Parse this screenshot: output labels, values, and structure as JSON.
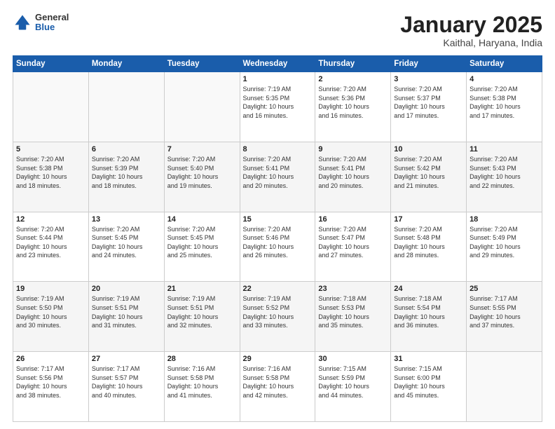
{
  "header": {
    "logo_general": "General",
    "logo_blue": "Blue",
    "title": "January 2025",
    "location": "Kaithal, Haryana, India"
  },
  "days_of_week": [
    "Sunday",
    "Monday",
    "Tuesday",
    "Wednesday",
    "Thursday",
    "Friday",
    "Saturday"
  ],
  "weeks": [
    [
      {
        "day": "",
        "info": ""
      },
      {
        "day": "",
        "info": ""
      },
      {
        "day": "",
        "info": ""
      },
      {
        "day": "1",
        "info": "Sunrise: 7:19 AM\nSunset: 5:35 PM\nDaylight: 10 hours\nand 16 minutes."
      },
      {
        "day": "2",
        "info": "Sunrise: 7:20 AM\nSunset: 5:36 PM\nDaylight: 10 hours\nand 16 minutes."
      },
      {
        "day": "3",
        "info": "Sunrise: 7:20 AM\nSunset: 5:37 PM\nDaylight: 10 hours\nand 17 minutes."
      },
      {
        "day": "4",
        "info": "Sunrise: 7:20 AM\nSunset: 5:38 PM\nDaylight: 10 hours\nand 17 minutes."
      }
    ],
    [
      {
        "day": "5",
        "info": "Sunrise: 7:20 AM\nSunset: 5:38 PM\nDaylight: 10 hours\nand 18 minutes."
      },
      {
        "day": "6",
        "info": "Sunrise: 7:20 AM\nSunset: 5:39 PM\nDaylight: 10 hours\nand 18 minutes."
      },
      {
        "day": "7",
        "info": "Sunrise: 7:20 AM\nSunset: 5:40 PM\nDaylight: 10 hours\nand 19 minutes."
      },
      {
        "day": "8",
        "info": "Sunrise: 7:20 AM\nSunset: 5:41 PM\nDaylight: 10 hours\nand 20 minutes."
      },
      {
        "day": "9",
        "info": "Sunrise: 7:20 AM\nSunset: 5:41 PM\nDaylight: 10 hours\nand 20 minutes."
      },
      {
        "day": "10",
        "info": "Sunrise: 7:20 AM\nSunset: 5:42 PM\nDaylight: 10 hours\nand 21 minutes."
      },
      {
        "day": "11",
        "info": "Sunrise: 7:20 AM\nSunset: 5:43 PM\nDaylight: 10 hours\nand 22 minutes."
      }
    ],
    [
      {
        "day": "12",
        "info": "Sunrise: 7:20 AM\nSunset: 5:44 PM\nDaylight: 10 hours\nand 23 minutes."
      },
      {
        "day": "13",
        "info": "Sunrise: 7:20 AM\nSunset: 5:45 PM\nDaylight: 10 hours\nand 24 minutes."
      },
      {
        "day": "14",
        "info": "Sunrise: 7:20 AM\nSunset: 5:45 PM\nDaylight: 10 hours\nand 25 minutes."
      },
      {
        "day": "15",
        "info": "Sunrise: 7:20 AM\nSunset: 5:46 PM\nDaylight: 10 hours\nand 26 minutes."
      },
      {
        "day": "16",
        "info": "Sunrise: 7:20 AM\nSunset: 5:47 PM\nDaylight: 10 hours\nand 27 minutes."
      },
      {
        "day": "17",
        "info": "Sunrise: 7:20 AM\nSunset: 5:48 PM\nDaylight: 10 hours\nand 28 minutes."
      },
      {
        "day": "18",
        "info": "Sunrise: 7:20 AM\nSunset: 5:49 PM\nDaylight: 10 hours\nand 29 minutes."
      }
    ],
    [
      {
        "day": "19",
        "info": "Sunrise: 7:19 AM\nSunset: 5:50 PM\nDaylight: 10 hours\nand 30 minutes."
      },
      {
        "day": "20",
        "info": "Sunrise: 7:19 AM\nSunset: 5:51 PM\nDaylight: 10 hours\nand 31 minutes."
      },
      {
        "day": "21",
        "info": "Sunrise: 7:19 AM\nSunset: 5:51 PM\nDaylight: 10 hours\nand 32 minutes."
      },
      {
        "day": "22",
        "info": "Sunrise: 7:19 AM\nSunset: 5:52 PM\nDaylight: 10 hours\nand 33 minutes."
      },
      {
        "day": "23",
        "info": "Sunrise: 7:18 AM\nSunset: 5:53 PM\nDaylight: 10 hours\nand 35 minutes."
      },
      {
        "day": "24",
        "info": "Sunrise: 7:18 AM\nSunset: 5:54 PM\nDaylight: 10 hours\nand 36 minutes."
      },
      {
        "day": "25",
        "info": "Sunrise: 7:17 AM\nSunset: 5:55 PM\nDaylight: 10 hours\nand 37 minutes."
      }
    ],
    [
      {
        "day": "26",
        "info": "Sunrise: 7:17 AM\nSunset: 5:56 PM\nDaylight: 10 hours\nand 38 minutes."
      },
      {
        "day": "27",
        "info": "Sunrise: 7:17 AM\nSunset: 5:57 PM\nDaylight: 10 hours\nand 40 minutes."
      },
      {
        "day": "28",
        "info": "Sunrise: 7:16 AM\nSunset: 5:58 PM\nDaylight: 10 hours\nand 41 minutes."
      },
      {
        "day": "29",
        "info": "Sunrise: 7:16 AM\nSunset: 5:58 PM\nDaylight: 10 hours\nand 42 minutes."
      },
      {
        "day": "30",
        "info": "Sunrise: 7:15 AM\nSunset: 5:59 PM\nDaylight: 10 hours\nand 44 minutes."
      },
      {
        "day": "31",
        "info": "Sunrise: 7:15 AM\nSunset: 6:00 PM\nDaylight: 10 hours\nand 45 minutes."
      },
      {
        "day": "",
        "info": ""
      }
    ]
  ]
}
